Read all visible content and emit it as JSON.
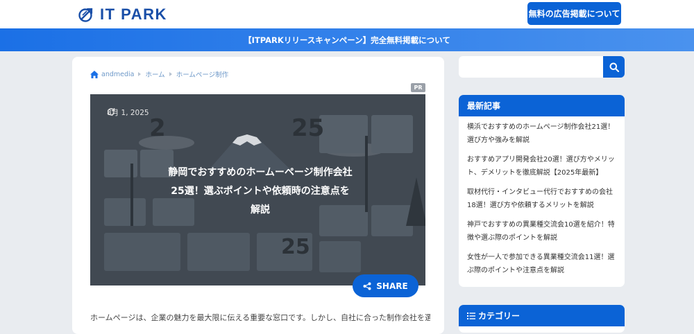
{
  "header": {
    "logo_text": "IT PARK",
    "ad_button": "無料の広告掲載について"
  },
  "banner": {
    "text": "【ITPARKリリースキャンペーン】完全無料掲載について"
  },
  "breadcrumb": [
    "andmedia",
    "ホーム",
    "ホームページ制作"
  ],
  "article": {
    "pr_badge": "PR",
    "date": "8月 1, 2025",
    "title": "静岡でおすすめのホームーページ制作会社25選！選ぶポイントや依頼時の注意点を解説",
    "share_label": "SHARE",
    "intro_text": "ホームページは、企業の魅力を最大限に伝える重要な窓口です。しかし、自社に合った制作会社を選ぶ"
  },
  "search": {
    "placeholder": ""
  },
  "sidebar": {
    "recent_title": "最新記事",
    "recent_items": [
      "横浜でおすすめのホームページ制作会社21選！選び方や強みを解説",
      "おすすめアプリ開発会社20選！選び方やメリット、デメリットを徹底解説【2025年最新】",
      "取材代行・インタビュー代行でおすすめの会社18選！選び方や依頼するメリットを解説",
      "神戸でおすすめの異業種交流会10選を紹介！特徴や選ぶ際のポイントを解説",
      "女性が一人で参加できる異業種交流会11選！選ぶ際のポイントや注意点を解説"
    ],
    "category_title": "カテゴリー"
  },
  "colors": {
    "brand": "#0b63d6",
    "logo": "#1a4fa8",
    "background": "#e9ecf0"
  }
}
